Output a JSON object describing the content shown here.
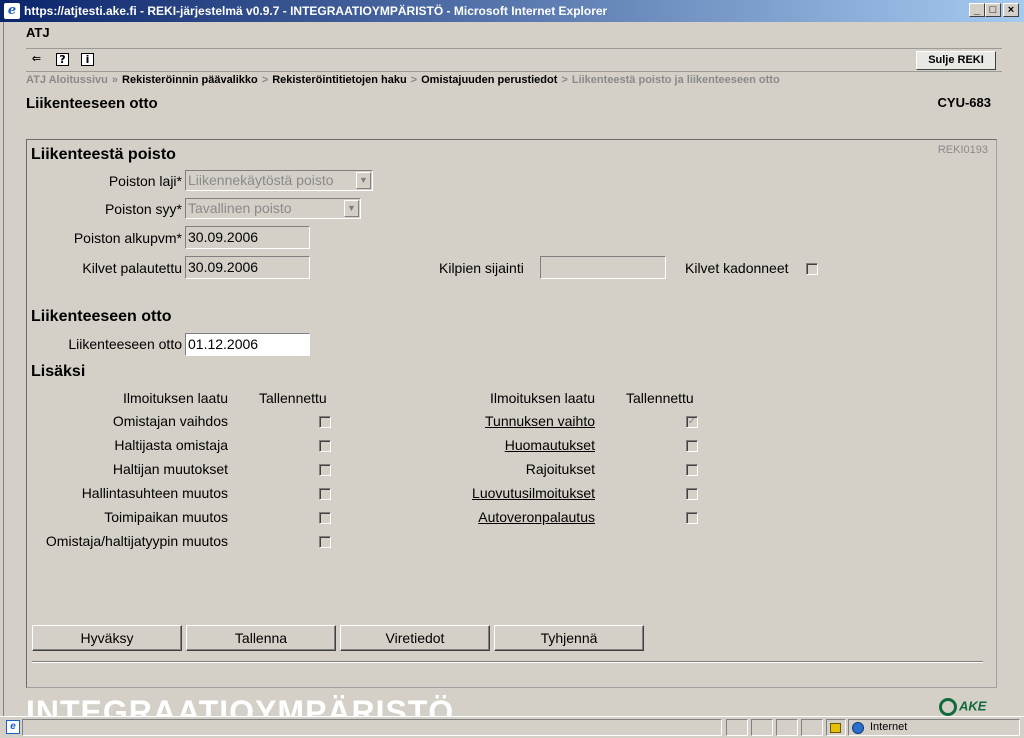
{
  "window": {
    "title": "https://atjtesti.ake.fi - REKI-järjestelmä v0.9.7 - INTEGRAATIOYMPÄRISTÖ - Microsoft Internet Explorer",
    "minimize": "_",
    "maximize": "□",
    "close": "×"
  },
  "app": {
    "name": "ATJ",
    "close_button": "Sulje REKI"
  },
  "breadcrumb": {
    "items": [
      "ATJ Aloitussivu",
      "Rekisteröinnin päävalikko",
      "Rekisteröintitietojen haku",
      "Omistajuuden perustiedot",
      "Liikenteestä poisto ja liikenteeseen otto"
    ],
    "sep1": "»",
    "sep": ">"
  },
  "page": {
    "title": "Liikenteeseen otto",
    "code": "CYU-683",
    "form_code": "REKI0193"
  },
  "removal": {
    "heading": "Liikenteestä poisto",
    "type_label": "Poiston laji*",
    "type_value": "Liikennekäytöstä poisto",
    "reason_label": "Poiston syy*",
    "reason_value": "Tavallinen poisto",
    "start_label": "Poiston alkupvm*",
    "start_value": "30.09.2006",
    "plates_returned_label": "Kilvet palautettu",
    "plates_returned_value": "30.09.2006",
    "plates_location_label": "Kilpien sijainti",
    "plates_location_value": "",
    "plates_lost_label": "Kilvet kadonneet",
    "plates_lost_checked": false
  },
  "entry": {
    "heading": "Liikenteeseen otto",
    "label": "Liikenteeseen otto",
    "value": "01.12.2006"
  },
  "extras": {
    "heading": "Lisäksi",
    "col_type": "Ilmoituksen laatu",
    "col_saved": "Tallennettu",
    "left": [
      {
        "label": "Omistajan vaihdos",
        "checked": false,
        "link": false
      },
      {
        "label": "Haltijasta omistaja",
        "checked": false,
        "link": false
      },
      {
        "label": "Haltijan muutokset",
        "checked": false,
        "link": false
      },
      {
        "label": "Hallintasuhteen muutos",
        "checked": false,
        "link": false
      },
      {
        "label": "Toimipaikan muutos",
        "checked": false,
        "link": false
      },
      {
        "label": "Omistaja/haltijatyypin muutos",
        "checked": false,
        "link": false
      }
    ],
    "right": [
      {
        "label": "Tunnuksen vaihto",
        "checked": true,
        "link": true
      },
      {
        "label": "Huomautukset",
        "checked": false,
        "link": true
      },
      {
        "label": "Rajoitukset",
        "checked": false,
        "link": false
      },
      {
        "label": "Luovutusilmoitukset",
        "checked": false,
        "link": true
      },
      {
        "label": "Autoveronpalautus",
        "checked": false,
        "link": true
      }
    ]
  },
  "buttons": {
    "accept": "Hyväksy",
    "save": "Tallenna",
    "official": "Viretiedot",
    "clear": "Tyhjennä"
  },
  "banner": "INTEGRAATIOYMPÄRISTÖ",
  "logo_text": "AKE",
  "statusbar": {
    "zone": "Internet"
  },
  "icons": {
    "back": "back-arrow-icon",
    "help": "help-icon",
    "info": "info-icon",
    "lock": "lock-icon",
    "globe": "globe-icon"
  }
}
